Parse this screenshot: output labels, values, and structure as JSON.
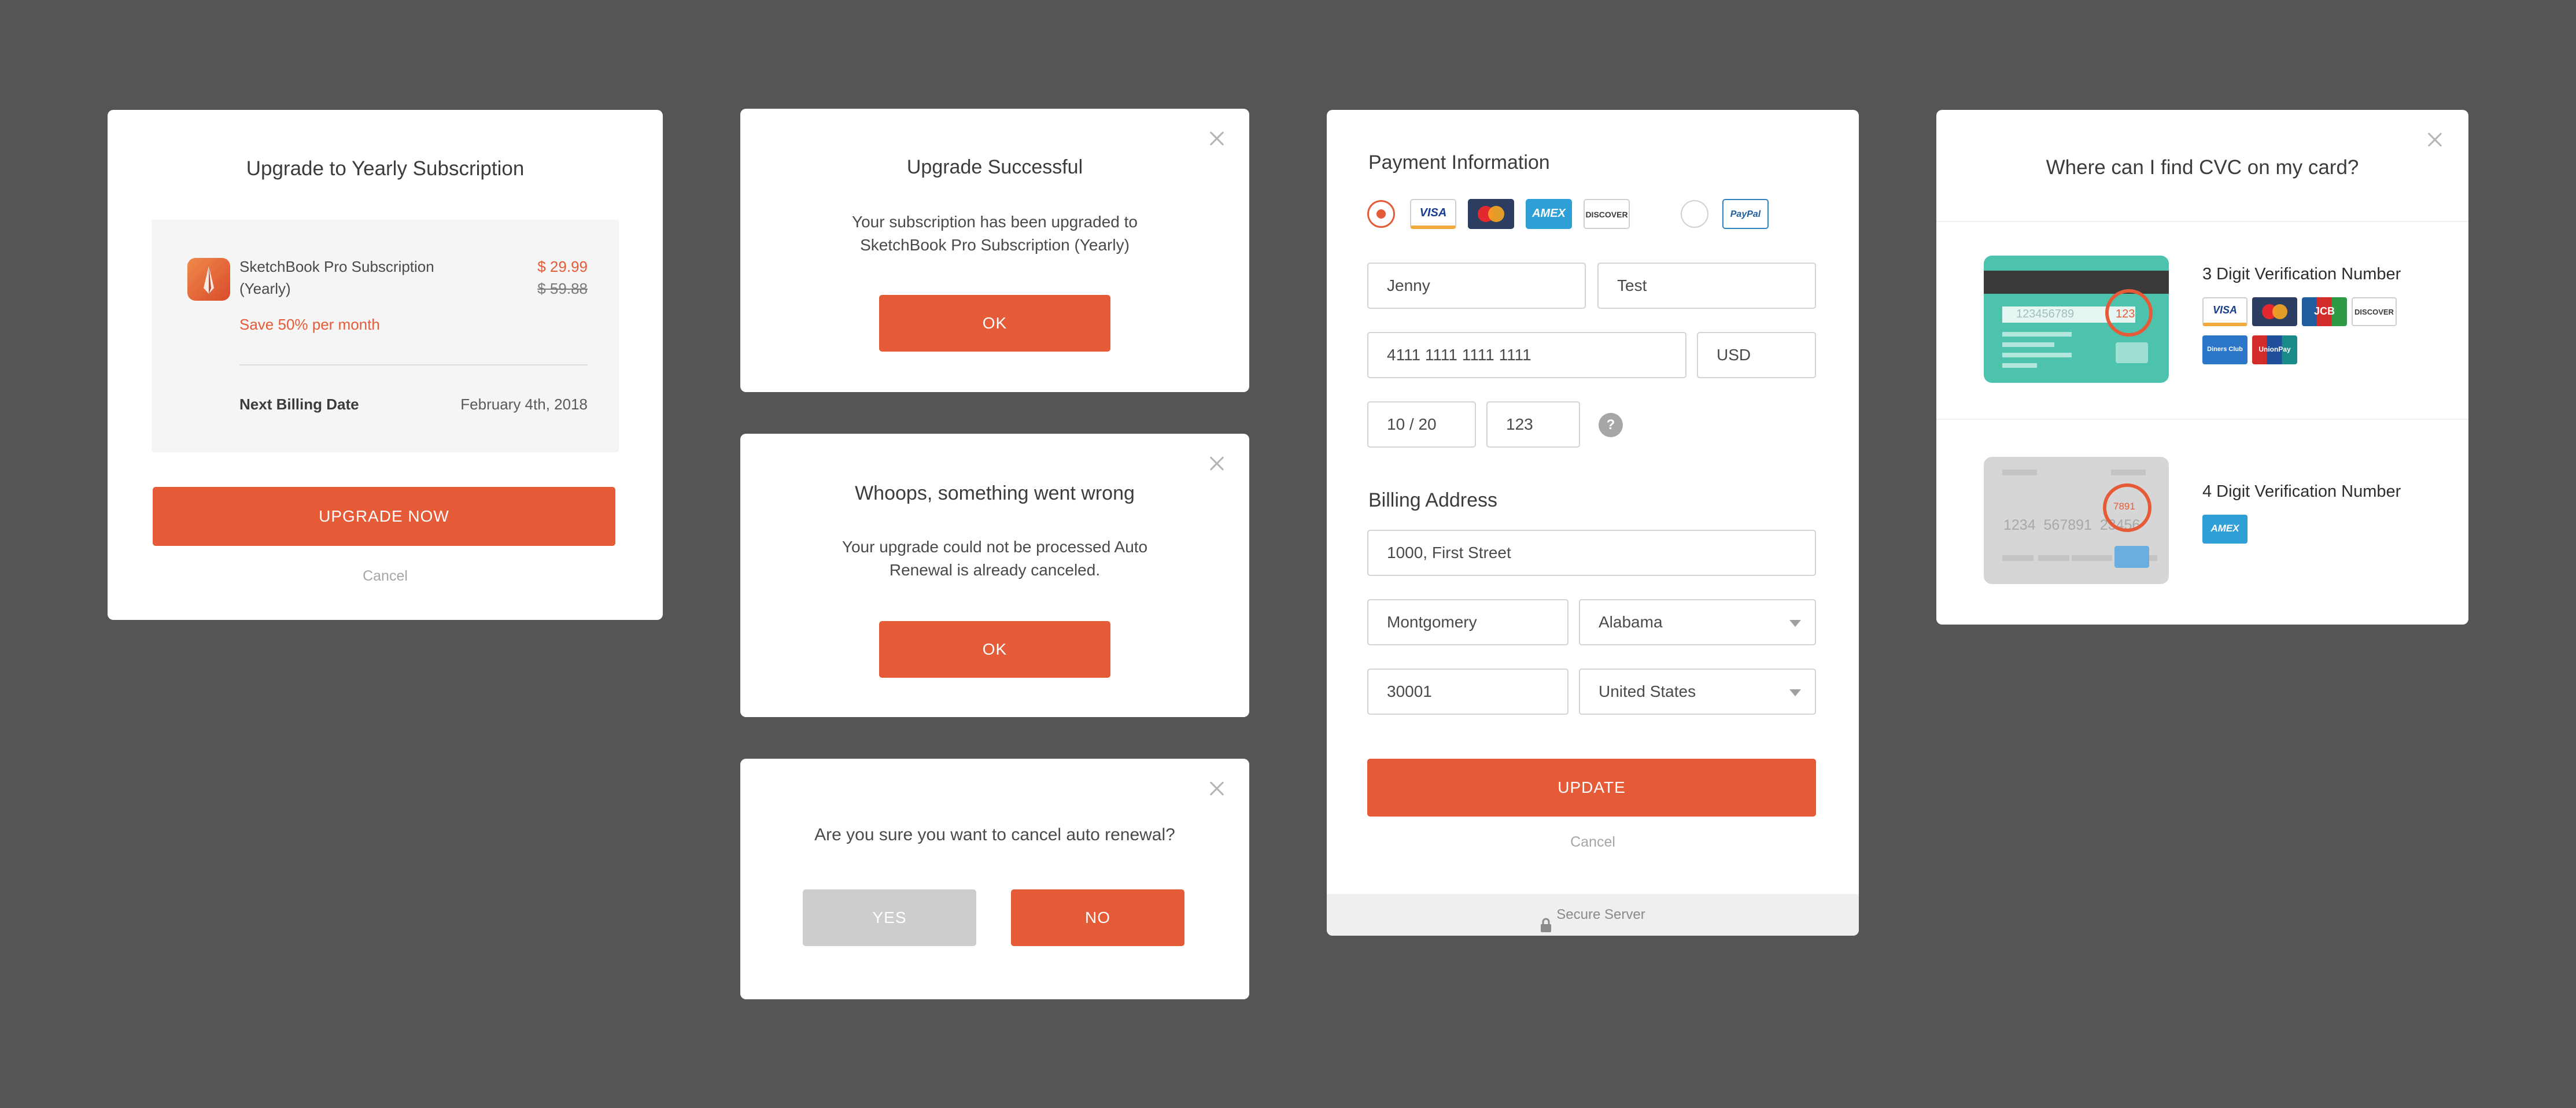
{
  "upgrade_dialog": {
    "title": "Upgrade to Yearly Subscription",
    "product_name_line1": "SketchBook Pro Subscription",
    "product_name_line2": "(Yearly)",
    "new_price": "$ 29.99",
    "old_price": "$ 59.88",
    "savings": "Save 50% per month",
    "billing_label": "Next Billing Date",
    "billing_date": "February 4th, 2018",
    "primary_button": "UPGRADE NOW",
    "cancel_link": "Cancel"
  },
  "success_dialog": {
    "title": "Upgrade Successful",
    "message_line1": "Your subscription has been upgraded to",
    "message_line2": "SketchBook Pro Subscription (Yearly)",
    "ok_button": "OK"
  },
  "error_dialog": {
    "title": "Whoops, something went wrong",
    "message_line1": "Your upgrade could not be processed Auto",
    "message_line2": "Renewal is already canceled.",
    "ok_button": "OK"
  },
  "confirm_dialog": {
    "message": "Are you sure you want to cancel auto renewal?",
    "yes_button": "YES",
    "no_button": "NO"
  },
  "payment_dialog": {
    "title": "Payment Information",
    "card_logos": [
      "VISA",
      "MasterCard",
      "AMEX",
      "DISCOVER"
    ],
    "paypal_label": "PayPal",
    "first_name": "Jenny",
    "last_name": "Test",
    "card_number": "4111 1111 1111 1111",
    "currency": "USD",
    "expiry": "10 / 20",
    "cvc": "123",
    "help_icon_label": "?",
    "billing_title": "Billing Address",
    "street": "1000, First Street",
    "city": "Montgomery",
    "state": "Alabama",
    "zip": "30001",
    "country": "United States",
    "update_button": "UPDATE",
    "cancel_link": "Cancel",
    "secure_label": "Secure Server"
  },
  "cvc_dialog": {
    "title": "Where can I find CVC on my card?",
    "three_digit_heading": "3 Digit Verification Number",
    "three_digit_card_number": "123456789",
    "three_digit_code": "123",
    "three_digit_logos": [
      "VISA",
      "MasterCard",
      "JCB",
      "DISCOVER",
      "Diners Club",
      "UnionPay"
    ],
    "four_digit_heading": "4 Digit Verification Number",
    "four_digit_card_number": "1234  567891  23456",
    "four_digit_code": "7891",
    "four_digit_logos": [
      "AMEX"
    ]
  },
  "colors": {
    "background": "#555555",
    "accent": "#e55b38",
    "card_teal": "#4dc2ad",
    "card_grey": "#d6d6d6"
  }
}
